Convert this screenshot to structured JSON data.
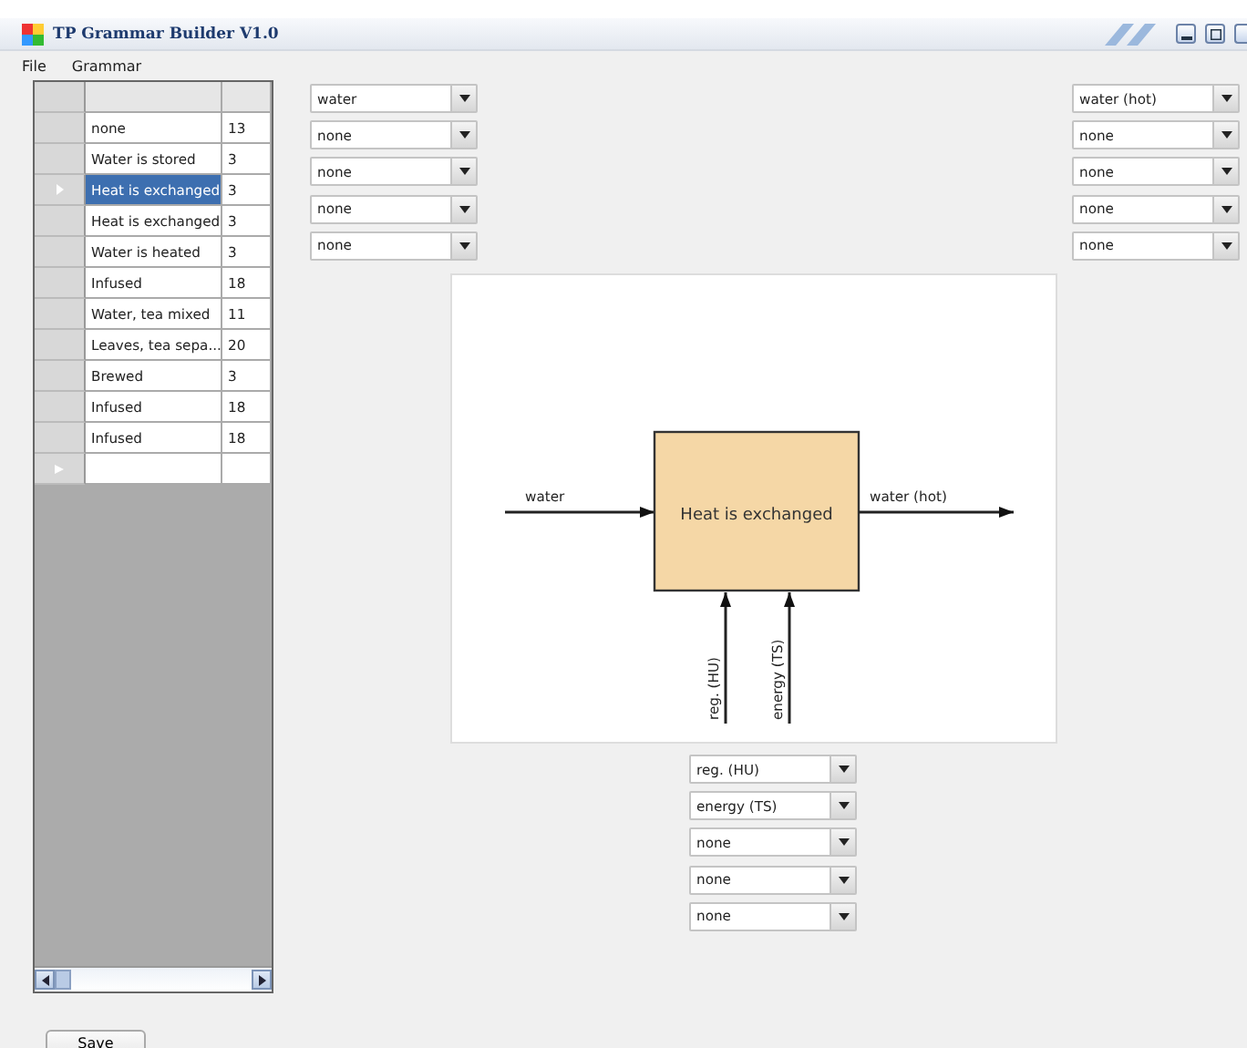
{
  "window": {
    "title": "TP Grammar Builder V1.0"
  },
  "menu": [
    "File",
    "Grammar"
  ],
  "table": {
    "rows": [
      {
        "operation": "none",
        "value": "13",
        "selected": false
      },
      {
        "operation": "Water is stored",
        "value": "3",
        "selected": false
      },
      {
        "operation": "Heat is exchanged",
        "value": "3",
        "selected": true
      },
      {
        "operation": "Heat is exchanged",
        "value": "3",
        "selected": false
      },
      {
        "operation": "Water is heated",
        "value": "3",
        "selected": false
      },
      {
        "operation": "Infused",
        "value": "18",
        "selected": false
      },
      {
        "operation": "Water, tea mixed",
        "value": "11",
        "selected": false
      },
      {
        "operation": "Leaves, tea sepa...",
        "value": "20",
        "selected": false
      },
      {
        "operation": "Brewed",
        "value": "3",
        "selected": false
      },
      {
        "operation": "Infused",
        "value": "18",
        "selected": false
      },
      {
        "operation": "Infused",
        "value": "18",
        "selected": false
      }
    ]
  },
  "inputs": [
    "water",
    "none",
    "none",
    "none",
    "none"
  ],
  "outputs": [
    "water (hot)",
    "none",
    "none",
    "none",
    "none"
  ],
  "diagram": {
    "process": "Heat is exchanged",
    "input": "water",
    "output": "water (hot)",
    "controls": [
      "reg. (HU)",
      "energy (TS)"
    ]
  },
  "mechanisms": [
    "reg. (HU)",
    "energy (TS)",
    "none",
    "none",
    "none"
  ],
  "save_button": "Save"
}
